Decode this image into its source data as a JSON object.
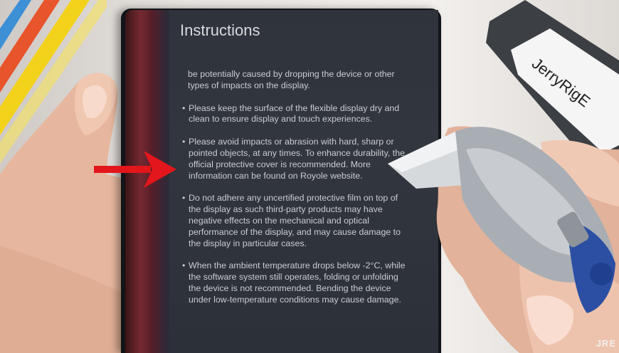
{
  "screen": {
    "title": "Instructions",
    "paragraphs": [
      {
        "bullet": "",
        "text": "be potentially caused by dropping the device or other types of impacts on the display."
      },
      {
        "bullet": "•",
        "text": "Please keep the surface of the flexible display dry and clean to ensure display and touch experiences."
      },
      {
        "bullet": "•",
        "text": "Please avoid impacts or abrasion with hard, sharp or pointed objects, at any times. To enhance durability, the official protective cover is recommended. More information can be found on Royole website."
      },
      {
        "bullet": "•",
        "text": "Do not adhere any uncertified protective film on top of the display as such third-party products may have negative effects on the mechanical and optical performance of the display, and may cause damage to the display in particular cases."
      },
      {
        "bullet": "•",
        "text": "When the ambient temperature drops below -2°C, while the software system still operates, folding or unfolding the device is not recommended. Bending the device under low-temperature conditions may cause damage."
      }
    ]
  },
  "tag": {
    "text": "JerryRigE"
  },
  "watermark": {
    "text": "JRE"
  },
  "colors": {
    "arrow": "#e3161c",
    "screen_bg": "#30343c",
    "screen_text": "#c9ccd0"
  },
  "icons": [
    "red-arrow-icon"
  ]
}
